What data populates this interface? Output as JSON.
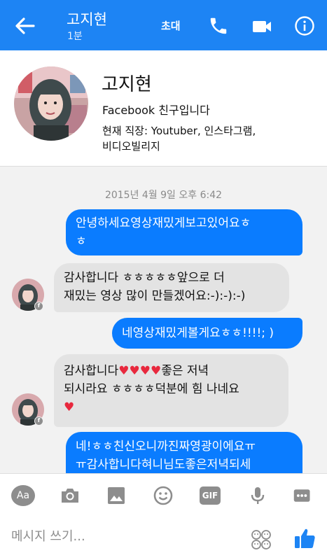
{
  "header": {
    "title": "고지현",
    "subtitle": "1분",
    "invite_label": "초대",
    "icons": [
      "back-arrow-icon",
      "phone-icon",
      "video-camera-icon",
      "info-icon"
    ]
  },
  "profile": {
    "name": "고지현",
    "friend_status": "Facebook 친구입니다",
    "work_line1": "현재 직장: Youtuber, 인스타그램,",
    "work_line2": "비디오빌리지"
  },
  "chat": {
    "timestamp": "2015년 4월 9일 오후 6:42",
    "messages": [
      {
        "direction": "out",
        "lines": [
          "안녕하세요영상재밌게보고있어요ㅎ",
          "ㅎ"
        ]
      },
      {
        "direction": "in",
        "lines": [
          "감사합니다 ㅎㅎㅎㅎㅎ앞으로 더",
          "재밌는 영상 많이 만들겠어요:-):-):-)"
        ]
      },
      {
        "direction": "out",
        "lines": [
          "네영상재밌게볼게요ㅎㅎ!!!!; )"
        ]
      },
      {
        "direction": "in",
        "lines": [
          "감사합니다♥♥♥♥좋은 저녁",
          "되시라요 ㅎㅎㅎㅎ덕분에 힘 나네요",
          "♥"
        ]
      },
      {
        "direction": "out",
        "lines": [
          "네!ㅎㅎ친신오니까진짜영광이에요ㅠ",
          "ㅠ감사합니다혀니님도좋은저녁되세"
        ]
      }
    ]
  },
  "toolbar": {
    "text_style_label": "Aa",
    "gif_label": "GIF",
    "icons": [
      "camera-icon",
      "image-icon",
      "emoji-icon",
      "gif-icon",
      "microphone-icon",
      "more-icon"
    ]
  },
  "composer": {
    "placeholder": "메시지 쓰기..."
  },
  "colors": {
    "brand": "#1d84f4",
    "outgoing_bubble": "#0a7cff",
    "incoming_bubble": "#e3e3e3",
    "heart": "#e8283d"
  }
}
